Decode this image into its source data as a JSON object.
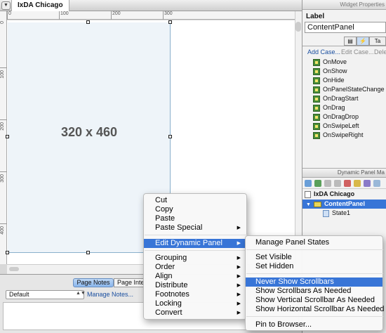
{
  "editor": {
    "page_tab": "IxDA Chicago",
    "ruler_h": [
      "0",
      "100",
      "200",
      "300"
    ],
    "ruler_v": [
      "0",
      "100",
      "200",
      "300",
      "400"
    ],
    "panel_size_label": "320 x 460"
  },
  "notes": {
    "tabs": [
      "Page Notes",
      "Page Inte"
    ],
    "select_value": "Default",
    "manage_link": "Manage Notes..."
  },
  "widget_properties": {
    "header": "Widget Properties",
    "label_heading": "Label",
    "label_value": "ContentPanel",
    "add_case": "Add Case...",
    "edit_case": "Edit Case...",
    "delete_case": "Dele",
    "events": [
      "OnMove",
      "OnShow",
      "OnHide",
      "OnPanelStateChange",
      "OnDragStart",
      "OnDrag",
      "OnDragDrop",
      "OnSwipeLeft",
      "OnSwipeRight"
    ]
  },
  "dynamic_panel_manager": {
    "header": "Dynamic Panel Ma",
    "tree": {
      "page": "IxDA Chicago",
      "panel": "ContentPanel",
      "state": "State1"
    }
  },
  "context_menu": {
    "items": [
      {
        "label": "Cut",
        "submenu": false
      },
      {
        "label": "Copy",
        "submenu": false
      },
      {
        "label": "Paste",
        "submenu": false
      },
      {
        "label": "Paste Special",
        "submenu": true
      },
      {
        "label": "Edit Dynamic Panel",
        "submenu": true
      },
      {
        "label": "Grouping",
        "submenu": true
      },
      {
        "label": "Order",
        "submenu": true
      },
      {
        "label": "Align",
        "submenu": true
      },
      {
        "label": "Distribute",
        "submenu": true
      },
      {
        "label": "Footnotes",
        "submenu": true
      },
      {
        "label": "Locking",
        "submenu": true
      },
      {
        "label": "Convert",
        "submenu": true
      }
    ],
    "highlighted": "Edit Dynamic Panel",
    "submenu_arrow": "▶"
  },
  "submenu": {
    "items": [
      "Manage Panel States",
      "Set Visible",
      "Set Hidden",
      "Never Show Scrollbars",
      "Show Scrollbars As Needed",
      "Show Vertical Scrollbar As Needed",
      "Show Horizontal Scrollbar As Needed",
      "Pin to Browser..."
    ],
    "highlighted": "Never Show Scrollbars"
  },
  "colors": {
    "selection": "#3875d7",
    "panel_fill": "#eef4f9",
    "link": "#1a4fa0"
  }
}
